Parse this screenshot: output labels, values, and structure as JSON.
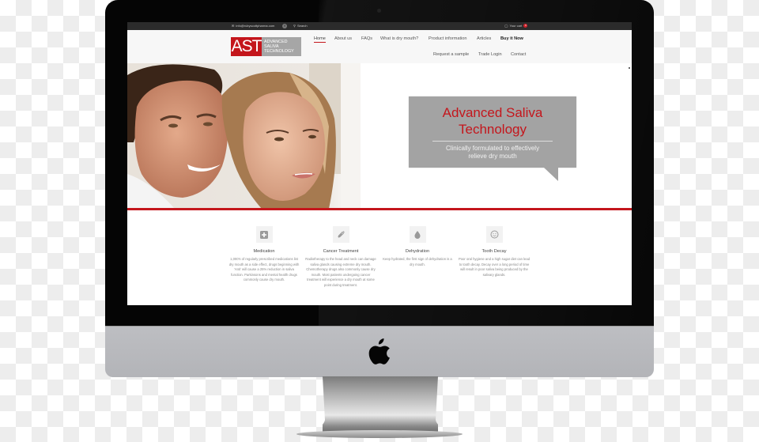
{
  "topbar": {
    "email": "info@rubyscottpharma.com",
    "facebook_icon": "facebook-icon",
    "search_label": "Search",
    "cart_label": "Your cart",
    "cart_count": "0"
  },
  "logo": {
    "mark": "AST",
    "line1": "ADVANCED",
    "line2": "SALIVA",
    "line3": "TECHNOLOGY"
  },
  "nav": {
    "primary": [
      {
        "label": "Home",
        "active": true
      },
      {
        "label": "About us"
      },
      {
        "label": "FAQs"
      },
      {
        "label": "What is dry mouth?"
      },
      {
        "label": "Product information"
      },
      {
        "label": "Articles"
      },
      {
        "label": "Buy it Now",
        "bold": true
      }
    ],
    "secondary": [
      {
        "label": "Request a sample"
      },
      {
        "label": "Trade Login"
      },
      {
        "label": "Contact"
      }
    ]
  },
  "hero": {
    "title_line1": "Advanced Saliva",
    "title_line2": "Technology",
    "subtitle_line1": "Clinically formulated to effectively",
    "subtitle_line2": "relieve dry mouth"
  },
  "features": [
    {
      "icon": "plus-square-icon",
      "title": "Medication",
      "text": "1,000's of regularly prescribed medications list dry mouth as a side effect, drugs beginning with 'Anti' will cause a 25% reduction in saliva function. Parkinsons and mental health drugs commonly cause dry mouth."
    },
    {
      "icon": "dropper-icon",
      "title": "Cancer Treatment",
      "text": "Radiotherapy to the head and neck can damage saliva glands causing extreme dry mouth. Chemotherapy drugs also commonly cause dry mouth. Most patients undergoing cancer treatment will experience a dry mouth at some point during treatment."
    },
    {
      "icon": "water-drop-icon",
      "title": "Dehydration",
      "text": "Keep hydrated, the first sign of dehydration is a dry mouth."
    },
    {
      "icon": "smiley-icon",
      "title": "Tooth Decay",
      "text": "Poor oral hygiene and a high sugar diet can lead to tooth decay. Decay over a long period of time will result in poor saliva being produced by the salivary glands."
    }
  ],
  "colors": {
    "brand_red": "#c4161c",
    "callout_gray": "#a3a3a3",
    "topbar": "#2b2b2b"
  }
}
